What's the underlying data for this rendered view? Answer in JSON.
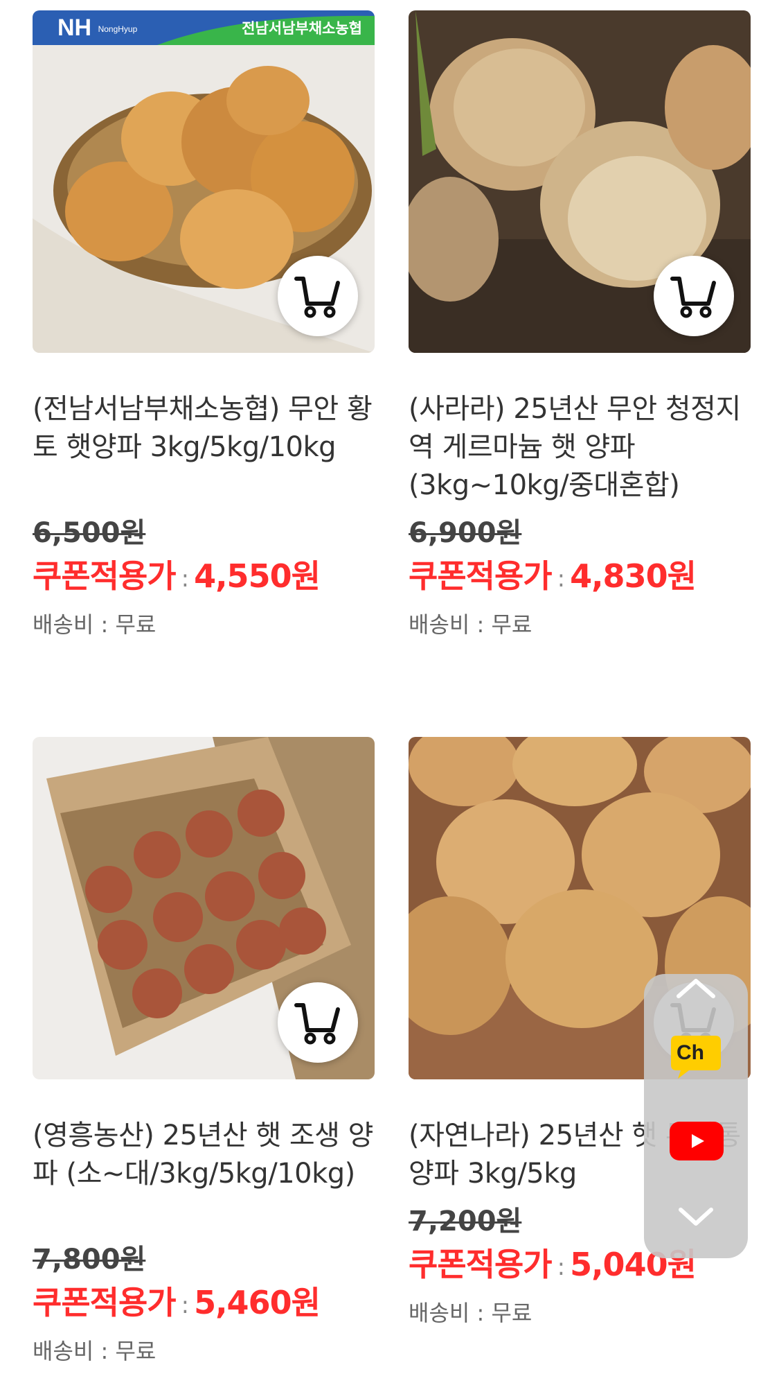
{
  "products": [
    {
      "title": "(전남서남부채소농협) 무안 황토 햇양파 3kg/5kg/10kg",
      "original_price": "6,500원",
      "coupon_label": "쿠폰적용가",
      "coupon_price": "4,550원",
      "shipping": "배송비 : 무료",
      "badge_brand": "NH",
      "badge_brand_sub": "NongHyup",
      "badge_text": "전남서남부채소농협"
    },
    {
      "title": "(사라라) 25년산 무안 청정지역 게르마늄 햇 양파 (3kg~10kg/중대혼합)",
      "original_price": "6,900원",
      "coupon_label": "쿠폰적용가",
      "coupon_price": "4,830원",
      "shipping": "배송비 : 무료"
    },
    {
      "title": "(영흥농산) 25년산 햇 조생 양파 (소~대/3kg/5kg/10kg)",
      "original_price": "7,800원",
      "coupon_label": "쿠폰적용가",
      "coupon_price": "5,460원",
      "shipping": "배송비 : 무료"
    },
    {
      "title": "(자연나라) 25년산 햇 무안통양파 3kg/5kg",
      "original_price": "7,200원",
      "coupon_label": "쿠폰적용가",
      "coupon_price": "5,040원",
      "shipping": "배송비 : 무료"
    }
  ],
  "separator": ":",
  "floating": {
    "chat_label": "Ch"
  },
  "colors": {
    "coupon_red": "#ff2d2d",
    "nh_green": "#39b54a",
    "nh_blue": "#1a4b9c"
  }
}
